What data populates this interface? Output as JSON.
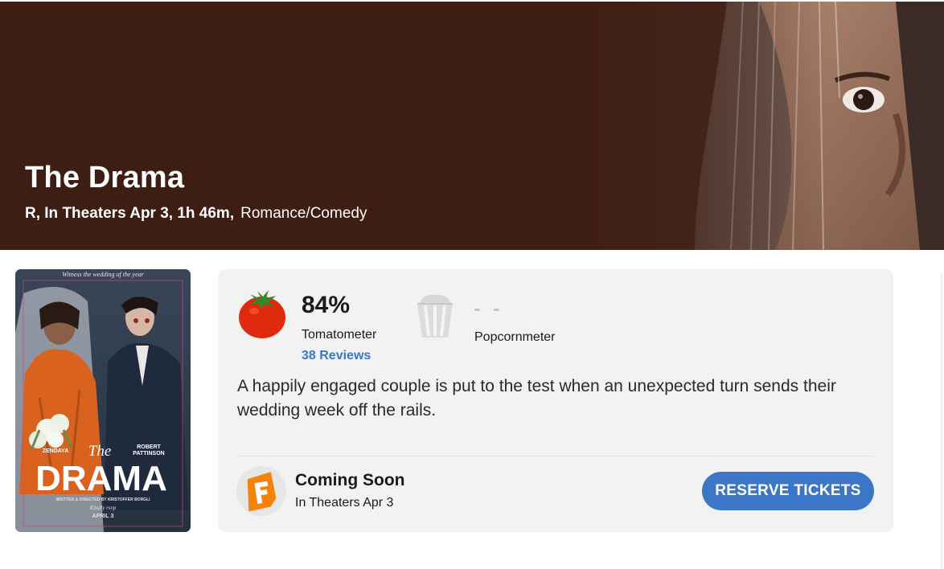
{
  "hero": {
    "title": "The Drama",
    "meta": "R, In Theaters Apr 3, 1h 46m,",
    "genre": "Romance/Comedy"
  },
  "poster": {
    "tagline": "Witness the wedding of the year",
    "actor_left": "ZENDAYA",
    "actor_right_1": "ROBERT",
    "actor_right_2": "PATTINSON",
    "script_title": "The",
    "big_title": "DRAMA",
    "credit": "WRITTEN & DIRECTED BY KRISTOFFER BORGLI",
    "rsvp_1": "Kindly rsvp",
    "release": "APRIL 3"
  },
  "scores": {
    "tomatometer_value": "84%",
    "tomatometer_label": "Tomatometer",
    "reviews_link": "38 Reviews",
    "popcornmeter_value": "- -",
    "popcornmeter_label": "Popcornmeter",
    "tomato_icon": "fresh-tomato-icon",
    "popcorn_icon": "empty-popcorn-bucket-icon"
  },
  "synopsis": "A happily engaged couple is put to the test when an unexpected turn sends their wedding week off the rails.",
  "tickets": {
    "provider_icon": "fandango-icon",
    "status": "Coming Soon",
    "release_line": "In Theaters Apr 3",
    "button_label": "RESERVE TICKETS"
  },
  "colors": {
    "hero_bg": "#3e1d13",
    "accent_blue": "#3b77c6",
    "tomato_red": "#e02a0f",
    "fandango_orange": "#f5820a",
    "card_bg": "#f2f2f2"
  }
}
